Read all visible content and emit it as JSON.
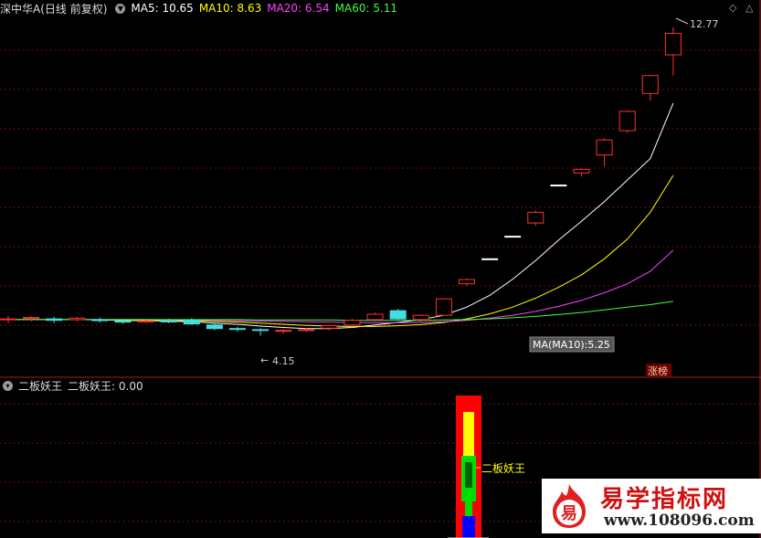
{
  "header": {
    "stock_name": "深中华A(日线 前复权)",
    "ma5": {
      "label": "MA5: 10.65",
      "color": "#ffffff"
    },
    "ma10": {
      "label": "MA10: 8.63",
      "color": "#ffff00"
    },
    "ma20": {
      "label": "MA20: 6.54",
      "color": "#ff40ff"
    },
    "ma60": {
      "label": "MA60: 5.11",
      "color": "#40ff40"
    }
  },
  "annotations": {
    "high_label": "12.77",
    "low_label": "4.15",
    "ma_tooltip": "MA(MA10):5.25",
    "zhangting_badge": "涨榜"
  },
  "sub_panel": {
    "indicator_name": "二板妖王",
    "indicator_value": "二板妖王: 0.00",
    "signal_label": "二板妖王"
  },
  "watermark": {
    "logo_char": "易",
    "title": "易学指标网",
    "url": "www.108096.com"
  },
  "chart_data": {
    "type": "candlestick",
    "ylim": [
      3.5,
      13.2
    ],
    "candles": [
      {
        "o": 4.6,
        "h": 4.7,
        "l": 4.5,
        "c": 4.62
      },
      {
        "o": 4.63,
        "h": 4.7,
        "l": 4.55,
        "c": 4.66
      },
      {
        "o": 4.62,
        "h": 4.68,
        "l": 4.5,
        "c": 4.58
      },
      {
        "o": 4.6,
        "h": 4.68,
        "l": 4.55,
        "c": 4.64
      },
      {
        "o": 4.6,
        "h": 4.66,
        "l": 4.52,
        "c": 4.57
      },
      {
        "o": 4.56,
        "h": 4.62,
        "l": 4.48,
        "c": 4.53
      },
      {
        "o": 4.55,
        "h": 4.6,
        "l": 4.5,
        "c": 4.56
      },
      {
        "o": 4.56,
        "h": 4.62,
        "l": 4.5,
        "c": 4.54
      },
      {
        "o": 4.58,
        "h": 4.64,
        "l": 4.45,
        "c": 4.48
      },
      {
        "o": 4.45,
        "h": 4.52,
        "l": 4.3,
        "c": 4.35
      },
      {
        "o": 4.35,
        "h": 4.4,
        "l": 4.26,
        "c": 4.33
      },
      {
        "o": 4.32,
        "h": 4.36,
        "l": 4.15,
        "c": 4.3
      },
      {
        "o": 4.28,
        "h": 4.34,
        "l": 4.2,
        "c": 4.3
      },
      {
        "o": 4.3,
        "h": 4.36,
        "l": 4.25,
        "c": 4.32
      },
      {
        "o": 4.36,
        "h": 4.45,
        "l": 4.3,
        "c": 4.43
      },
      {
        "o": 4.45,
        "h": 4.62,
        "l": 4.4,
        "c": 4.58
      },
      {
        "o": 4.6,
        "h": 4.8,
        "l": 4.55,
        "c": 4.75
      },
      {
        "o": 4.85,
        "h": 4.9,
        "l": 4.58,
        "c": 4.62
      },
      {
        "o": 4.6,
        "h": 4.75,
        "l": 4.52,
        "c": 4.72
      },
      {
        "o": 4.72,
        "h": 5.2,
        "l": 4.7,
        "c": 5.18
      },
      {
        "o": 5.6,
        "h": 5.75,
        "l": 5.55,
        "c": 5.72
      },
      {
        "o": 6.3,
        "h": 6.3,
        "l": 6.3,
        "c": 6.3
      },
      {
        "o": 6.93,
        "h": 6.93,
        "l": 6.93,
        "c": 6.93
      },
      {
        "o": 7.3,
        "h": 7.65,
        "l": 7.22,
        "c": 7.6
      },
      {
        "o": 8.36,
        "h": 8.36,
        "l": 8.36,
        "c": 8.36
      },
      {
        "o": 8.7,
        "h": 8.82,
        "l": 8.6,
        "c": 8.8
      },
      {
        "o": 9.2,
        "h": 9.68,
        "l": 8.88,
        "c": 9.62
      },
      {
        "o": 9.88,
        "h": 10.45,
        "l": 9.82,
        "c": 10.42
      },
      {
        "o": 10.92,
        "h": 11.45,
        "l": 10.72,
        "c": 11.42
      },
      {
        "o": 12.0,
        "h": 12.77,
        "l": 11.42,
        "c": 12.6
      }
    ],
    "ma_lines": [
      {
        "name": "MA5",
        "color": "#ffffff",
        "values": [
          4.6,
          4.6,
          4.6,
          4.6,
          4.59,
          4.58,
          4.57,
          4.56,
          4.54,
          4.5,
          4.47,
          4.42,
          4.38,
          4.35,
          4.35,
          4.38,
          4.45,
          4.52,
          4.6,
          4.72,
          4.95,
          5.28,
          5.73,
          6.25,
          6.82,
          7.35,
          7.9,
          8.5,
          9.1,
          10.65
        ]
      },
      {
        "name": "MA10",
        "color": "#ffff00",
        "values": [
          4.6,
          4.6,
          4.6,
          4.6,
          4.6,
          4.59,
          4.58,
          4.58,
          4.57,
          4.55,
          4.53,
          4.5,
          4.47,
          4.44,
          4.42,
          4.41,
          4.41,
          4.43,
          4.46,
          4.52,
          4.62,
          4.76,
          4.95,
          5.2,
          5.5,
          5.85,
          6.3,
          6.85,
          7.6,
          8.63
        ]
      },
      {
        "name": "MA20",
        "color": "#ff40ff",
        "values": [
          4.6,
          4.6,
          4.6,
          4.6,
          4.6,
          4.6,
          4.6,
          4.59,
          4.59,
          4.58,
          4.57,
          4.56,
          4.55,
          4.54,
          4.53,
          4.52,
          4.51,
          4.51,
          4.52,
          4.54,
          4.58,
          4.64,
          4.72,
          4.83,
          4.97,
          5.14,
          5.35,
          5.6,
          5.95,
          6.54
        ]
      },
      {
        "name": "MA60",
        "color": "#40ff40",
        "values": [
          4.6,
          4.6,
          4.6,
          4.6,
          4.6,
          4.6,
          4.6,
          4.6,
          4.6,
          4.6,
          4.6,
          4.59,
          4.59,
          4.59,
          4.59,
          4.58,
          4.58,
          4.58,
          4.58,
          4.59,
          4.6,
          4.62,
          4.65,
          4.69,
          4.74,
          4.8,
          4.87,
          4.95,
          5.02,
          5.11
        ]
      }
    ]
  }
}
